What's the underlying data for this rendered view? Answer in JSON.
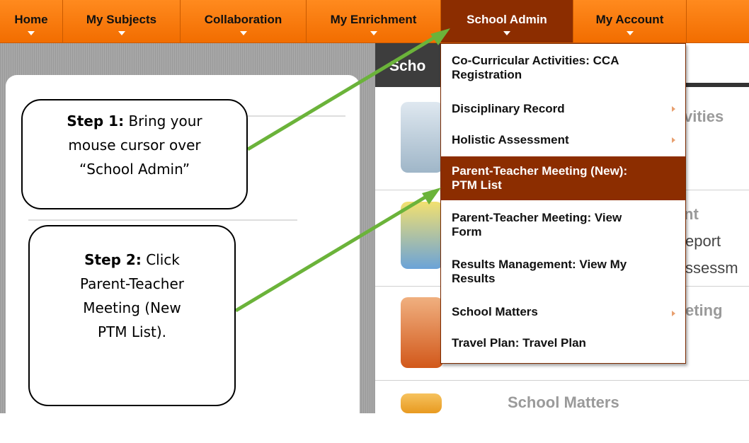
{
  "nav": {
    "items": [
      {
        "label": "Home"
      },
      {
        "label": "My Subjects"
      },
      {
        "label": "Collaboration"
      },
      {
        "label": "My Enrichment"
      },
      {
        "label": "School Admin"
      },
      {
        "label": "My Account"
      }
    ],
    "active_label": "School Admin"
  },
  "content": {
    "section_title": "Scho",
    "fragments": [
      "vities",
      "nt",
      "eport",
      "ssessm",
      "eting"
    ],
    "bottom_label": "School Matters"
  },
  "dropdown": {
    "items": [
      {
        "line1": "Co-Curricular Activities: CCA",
        "line2": "Registration",
        "submenu": false
      },
      {
        "line1": "Disciplinary Record",
        "line2": "",
        "submenu": true
      },
      {
        "line1": "Holistic Assessment",
        "line2": "",
        "submenu": true
      },
      {
        "line1": "Parent-Teacher Meeting (New):",
        "line2": "PTM List",
        "submenu": false
      },
      {
        "line1": "Parent-Teacher Meeting: View",
        "line2": "Form",
        "submenu": false
      },
      {
        "line1": "Results Management: View My",
        "line2": "Results",
        "submenu": false
      },
      {
        "line1": "School Matters",
        "line2": "",
        "submenu": true
      },
      {
        "line1": "Travel Plan: Travel Plan",
        "line2": "",
        "submenu": false
      }
    ],
    "active_index": 3
  },
  "callouts": {
    "step1": {
      "label": "Step 1:",
      "lines": [
        "Bring your",
        "mouse cursor over",
        "“School Admin”"
      ]
    },
    "step2": {
      "label": "Step 2:",
      "lines": [
        "Click",
        "Parent-Teacher",
        "Meeting (New",
        "PTM List)."
      ]
    }
  },
  "colors": {
    "nav_orange": "#f47a10",
    "active_brown": "#8c2d00",
    "arrow_green": "#6bb33a"
  }
}
